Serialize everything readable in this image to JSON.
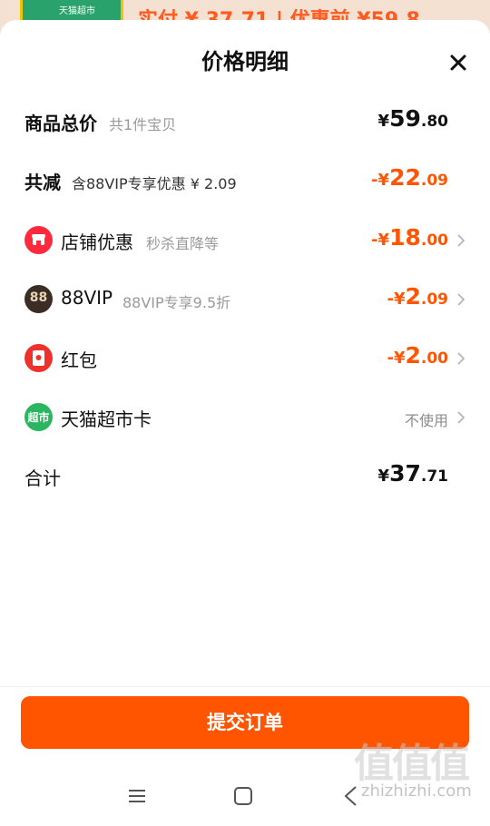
{
  "background": {
    "thumb_label": "天猫超市",
    "text": "实付 ¥ 37.71 | 优惠前 ¥59.8"
  },
  "sheet": {
    "title": "价格明细",
    "close_icon": "close-icon"
  },
  "rows": {
    "total": {
      "label": "商品总价",
      "sub": "共1件宝贝",
      "cur": "¥",
      "int": "59",
      "dec": ".80"
    },
    "reduce": {
      "label": "共减",
      "sub": "含88VIP专享优惠 ¥ 2.09",
      "cur": "-¥",
      "int": "22",
      "dec": ".09"
    },
    "shop": {
      "label": "店铺优惠",
      "sub": "秒杀直降等",
      "cur": "-¥",
      "int": "18",
      "dec": ".00",
      "icon": "shop-icon",
      "icon_color": "#ff2a3d"
    },
    "vip": {
      "label": "88VIP",
      "sub": "88VIP专享9.5折",
      "cur": "-¥",
      "int": "2",
      "dec": ".09",
      "icon": "vip-88-icon",
      "icon_text": "88",
      "icon_color": "#3b2c25"
    },
    "redpack": {
      "label": "红包",
      "cur": "-¥",
      "int": "2",
      "dec": ".00",
      "icon": "red-packet-icon",
      "icon_color": "#f0302a"
    },
    "card": {
      "label": "天猫超市卡",
      "value": "不使用",
      "icon": "supermarket-card-icon",
      "icon_text": "超市",
      "icon_color": "#2bb561"
    },
    "sum": {
      "label": "合计",
      "cur": "¥",
      "int": "37",
      "dec": ".71"
    }
  },
  "submit": {
    "label": "提交订单"
  },
  "navbar": {
    "menu_icon": "menu-icon",
    "home_icon": "home-square-icon",
    "back_icon": "back-icon"
  },
  "watermark": {
    "big": "值值值",
    "small": "zhizhizhi.com"
  },
  "colors": {
    "accent": "#ff5500"
  }
}
